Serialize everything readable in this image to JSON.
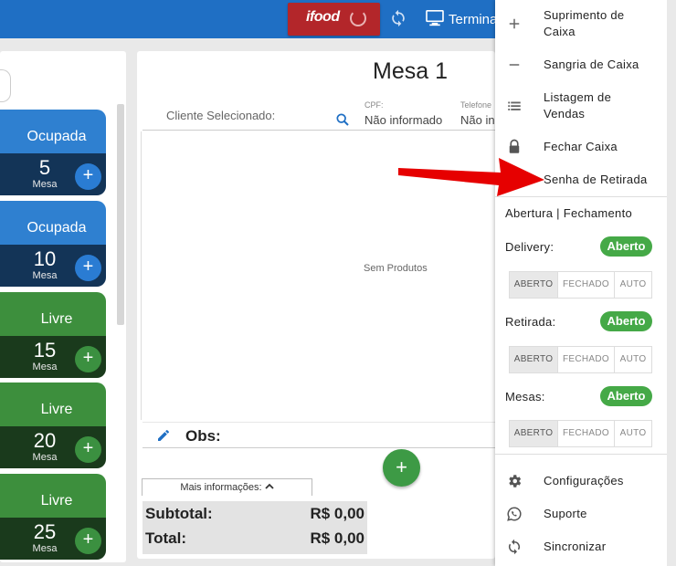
{
  "header": {
    "ifood_logo": "ifood",
    "terminal_label": "Termina"
  },
  "tables": [
    {
      "status": "Ocupada",
      "number": "5",
      "sub": "Mesa",
      "kind": "occupied"
    },
    {
      "status": "Ocupada",
      "number": "10",
      "sub": "Mesa",
      "kind": "occupied"
    },
    {
      "status": "Livre",
      "number": "15",
      "sub": "Mesa",
      "kind": "free"
    },
    {
      "status": "Livre",
      "number": "20",
      "sub": "Mesa",
      "kind": "free"
    },
    {
      "status": "Livre",
      "number": "25",
      "sub": "Mesa",
      "kind": "free"
    }
  ],
  "order": {
    "title": "Mesa 1",
    "client_label": "Cliente Selecionado:",
    "cpf_label": "CPF:",
    "cpf_value": "Não informado",
    "phone_label": "Telefone",
    "phone_value": "Não in",
    "empty": "Sem Produtos",
    "obs_label": "Obs:",
    "more_info": "Mais informações:",
    "subtotal_label": "Subtotal:",
    "subtotal_value": "R$ 0,00",
    "total_label": "Total:",
    "total_value": "R$ 0,00",
    "add_symbol": "+"
  },
  "menu": {
    "items": [
      {
        "label": "Suprimento de Caixa",
        "icon": "plus-icon"
      },
      {
        "label": "Sangria de Caixa",
        "icon": "minus-icon"
      },
      {
        "label": "Listagem de Vendas",
        "icon": "list-icon"
      },
      {
        "label": "Fechar Caixa",
        "icon": "lock-icon"
      },
      {
        "label": "Senha de Retirada",
        "icon": "ticket-icon"
      }
    ],
    "section_title": "Abertura | Fechamento",
    "statuses": [
      {
        "label": "Delivery:",
        "state": "Aberto"
      },
      {
        "label": "Retirada:",
        "state": "Aberto"
      },
      {
        "label": "Mesas:",
        "state": "Aberto"
      }
    ],
    "segment_options": [
      "ABERTO",
      "FECHADO",
      "AUTO"
    ],
    "bottom_items": [
      {
        "label": "Configurações",
        "icon": "gear-icon"
      },
      {
        "label": "Suporte",
        "icon": "whatsapp-icon"
      },
      {
        "label": "Sincronizar",
        "icon": "sync-icon"
      }
    ]
  },
  "colors": {
    "accent_blue": "#1f6fc4",
    "green": "#45a947",
    "ifood_red": "#b3262a",
    "annotation_arrow": "#e60000"
  }
}
